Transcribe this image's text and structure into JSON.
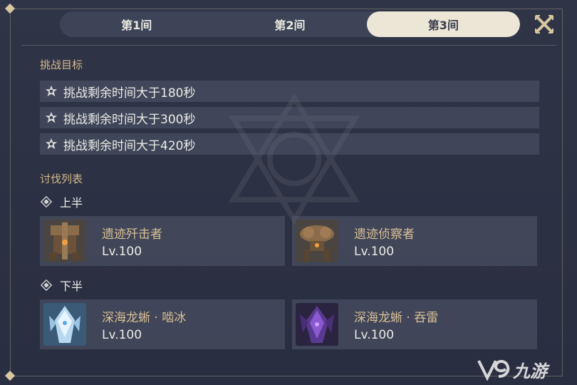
{
  "tabs": [
    {
      "label": "第1间",
      "active": false
    },
    {
      "label": "第2间",
      "active": false
    },
    {
      "label": "第3间",
      "active": true
    }
  ],
  "close_icon": "close-x-icon",
  "challenge": {
    "title": "挑战目标",
    "goals": [
      "挑战剩余时间大于180秒",
      "挑战剩余时间大于300秒",
      "挑战剩余时间大于420秒"
    ]
  },
  "enemy_list": {
    "title": "讨伐列表",
    "halves": [
      {
        "label": "上半",
        "enemies": [
          {
            "name": "遗迹歼击者",
            "level": "Lv.100",
            "portrait": "ruin-destroyer-portrait"
          },
          {
            "name": "遗迹侦察者",
            "level": "Lv.100",
            "portrait": "ruin-scout-portrait"
          }
        ]
      },
      {
        "label": "下半",
        "enemies": [
          {
            "name": "深海龙蜥 · 啮冰",
            "level": "Lv.100",
            "portrait": "frost-abyss-lizard-portrait"
          },
          {
            "name": "深海龙蜥 · 吞雷",
            "level": "Lv.100",
            "portrait": "electro-abyss-lizard-portrait"
          }
        ]
      }
    ]
  },
  "watermark": {
    "text": "九游",
    "icon": "9game-logo-icon"
  },
  "colors": {
    "background": "#2b2f42",
    "tab_active": "#ece6d6",
    "section_title": "#d4b98a",
    "enemy_name": "#d9c095",
    "text": "#ecebe6"
  }
}
